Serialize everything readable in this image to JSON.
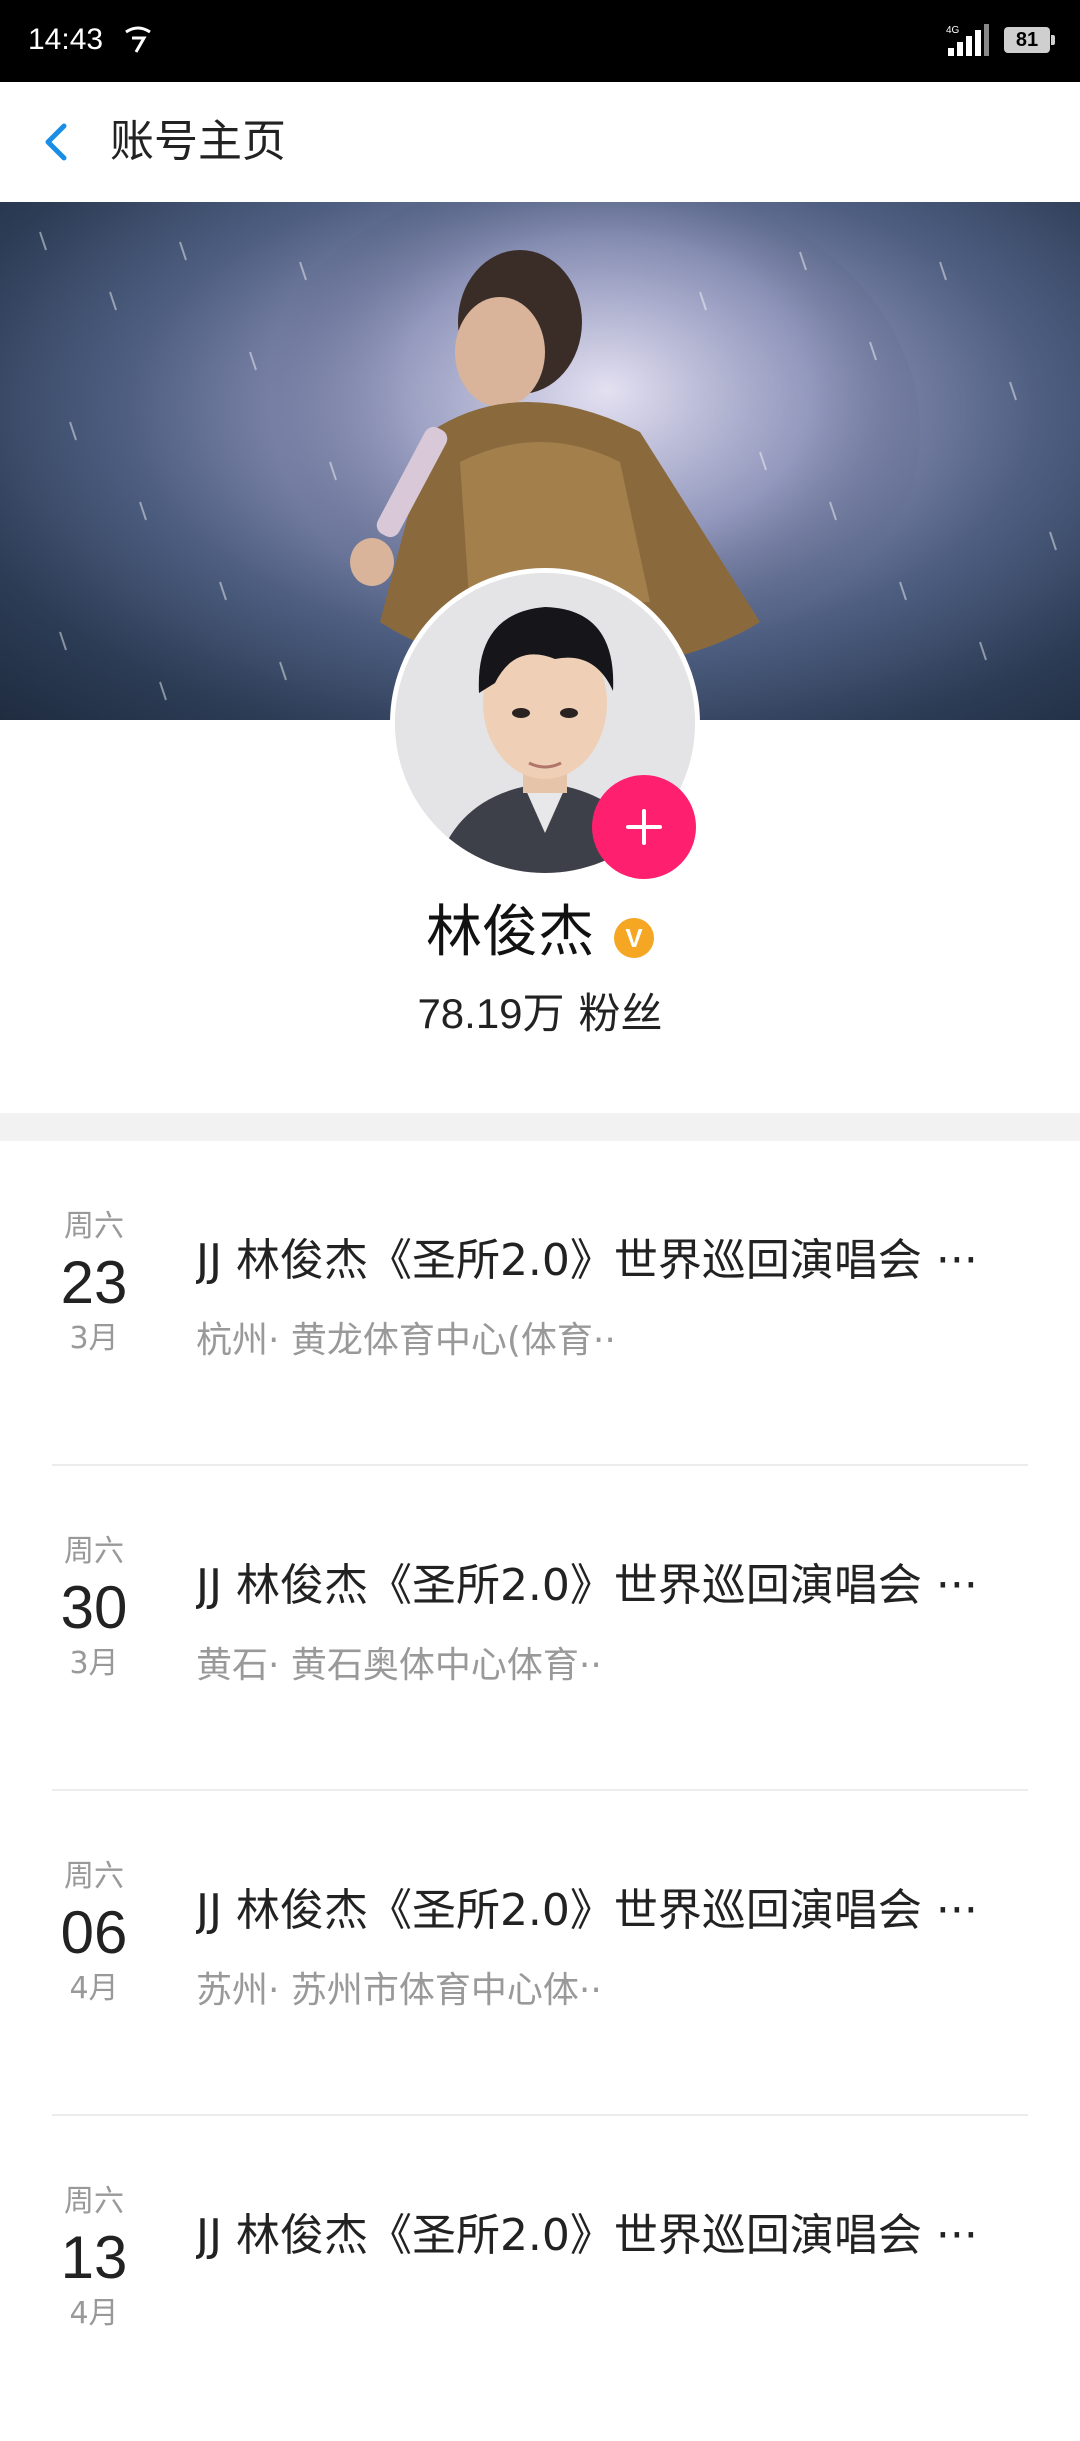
{
  "status_bar": {
    "time": "14:43",
    "network": "4G",
    "battery": "81"
  },
  "header": {
    "title": "账号主页"
  },
  "profile": {
    "name": "林俊杰",
    "verified_label": "V",
    "fans_count": "78.19万",
    "fans_label": "粉丝"
  },
  "events": [
    {
      "weekday": "周六",
      "day": "23",
      "month": "3月",
      "title": "JJ 林俊杰《圣所2.0》世界巡回演唱会 ···",
      "venue": "杭州· 黄龙体育中心(体育··"
    },
    {
      "weekday": "周六",
      "day": "30",
      "month": "3月",
      "title": "JJ 林俊杰《圣所2.0》世界巡回演唱会 ···",
      "venue": "黄石· 黄石奥体中心体育··"
    },
    {
      "weekday": "周六",
      "day": "06",
      "month": "4月",
      "title": "JJ 林俊杰《圣所2.0》世界巡回演唱会 ···",
      "venue": "苏州· 苏州市体育中心体··"
    },
    {
      "weekday": "周六",
      "day": "13",
      "month": "4月",
      "title": "JJ 林俊杰《圣所2.0》世界巡回演唱会 ···",
      "venue": ""
    }
  ],
  "colors": {
    "accent": "#1a8ee6",
    "follow": "#ff1f6f",
    "verified": "#f5a623"
  }
}
